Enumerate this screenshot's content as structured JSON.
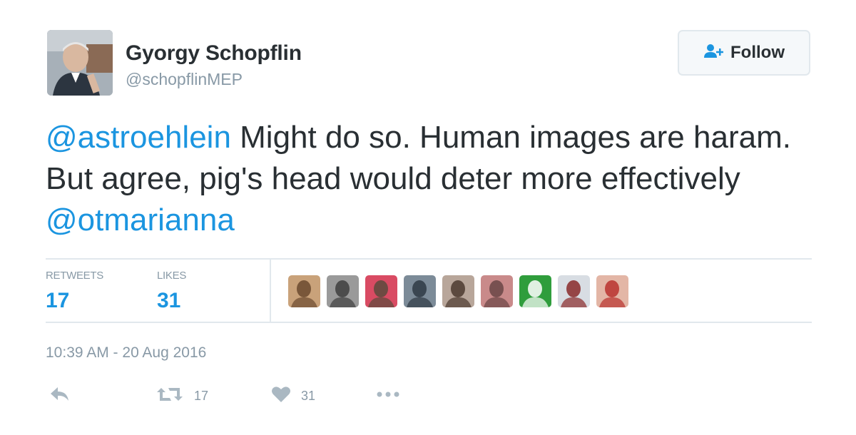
{
  "author": {
    "name": "Gyorgy Schopflin",
    "handle": "@schopflinMEP"
  },
  "follow_button": {
    "label": "Follow",
    "icon": "follow-user-plus-icon"
  },
  "tweet": {
    "segments": [
      {
        "type": "mention",
        "text": "@astroehlein"
      },
      {
        "type": "text",
        "text": " Might do so. Human images are haram. But agree, pig's head would deter more effectively "
      },
      {
        "type": "mention",
        "text": "@otmarianna"
      }
    ]
  },
  "stats": {
    "retweets_label": "RETWEETS",
    "retweets_value": "17",
    "likes_label": "LIKES",
    "likes_value": "31"
  },
  "likers": [
    {
      "name": "liker-avatar-1",
      "colors": [
        "#c9a27a",
        "#6b4a2f"
      ]
    },
    {
      "name": "liker-avatar-2",
      "colors": [
        "#9a9a9a",
        "#3e3e3e"
      ]
    },
    {
      "name": "liker-avatar-3",
      "colors": [
        "#d94b63",
        "#5a4a3c"
      ]
    },
    {
      "name": "liker-avatar-4",
      "colors": [
        "#7c8b98",
        "#2f3a44"
      ]
    },
    {
      "name": "liker-avatar-5",
      "colors": [
        "#b8a69a",
        "#4b3a2f"
      ]
    },
    {
      "name": "liker-avatar-6",
      "colors": [
        "#c98a8a",
        "#6a4545"
      ]
    },
    {
      "name": "liker-avatar-7",
      "colors": [
        "#2f9d3c",
        "#ffffff"
      ]
    },
    {
      "name": "liker-avatar-8",
      "colors": [
        "#d8dde3",
        "#8a2a2a"
      ]
    },
    {
      "name": "liker-avatar-9",
      "colors": [
        "#e3b6a6",
        "#b8322e"
      ]
    }
  ],
  "timestamp": "10:39 AM - 20 Aug 2016",
  "actions": {
    "reply_icon": "reply-icon",
    "retweet_icon": "retweet-icon",
    "retweet_count": "17",
    "like_icon": "heart-icon",
    "like_count": "31",
    "more_icon": "more-dots-icon"
  },
  "colors": {
    "link": "#1b95e0",
    "text": "#292f33",
    "muted": "#8899a6",
    "border": "#e1e8ed"
  }
}
